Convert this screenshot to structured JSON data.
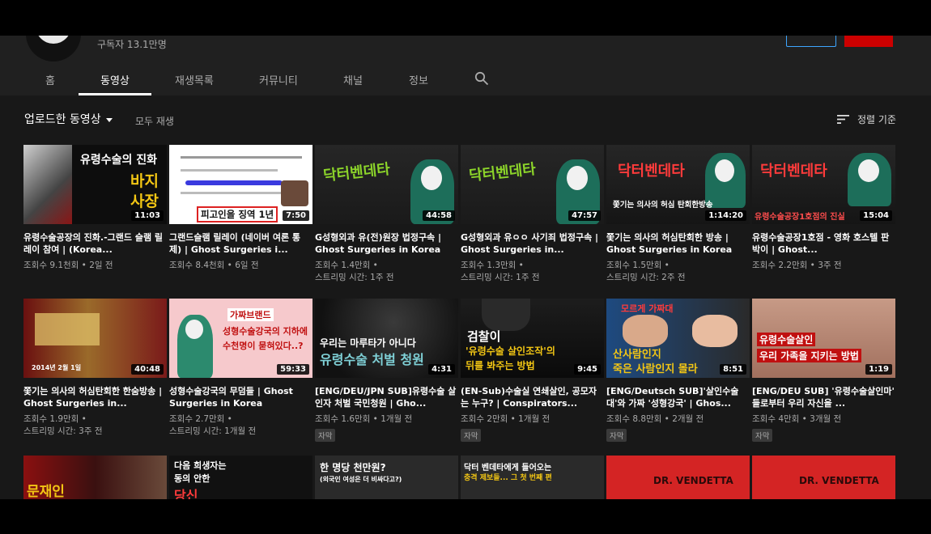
{
  "channel": {
    "subscribers": "구독자 13.1만명"
  },
  "tabs": [
    {
      "label": "홈"
    },
    {
      "label": "동영상"
    },
    {
      "label": "재생목록"
    },
    {
      "label": "커뮤니티"
    },
    {
      "label": "채널"
    },
    {
      "label": "정보"
    }
  ],
  "section": {
    "title": "업로드한 동영상",
    "play_all": "모두 재생",
    "sort": "정렬 기준"
  },
  "videos": [
    {
      "title": "유령수술공장의 진화.-그랜드 슬램 릴레이 참여 | (Korea...",
      "meta1": "조회수 9.1천회 • 2일 전",
      "meta2": "",
      "duration": "11:03",
      "thumb_text1": "유령수술의 진화",
      "thumb_text2": "바지",
      "thumb_text3": "사장"
    },
    {
      "title": "그랜드슬램 릴레이 (네이버 여론 통제) | Ghost Surgeries i...",
      "meta1": "조회수 8.4천회 • 6일 전",
      "meta2": "",
      "duration": "7:50",
      "thumb_text1": "피고인을 징역 1년"
    },
    {
      "title": "G성형외과 유(전)원장 법정구속 | Ghost Surgeries in Korea",
      "meta1": "조회수 1.4만회 •",
      "meta2": "스트리밍 시간: 1주 전",
      "duration": "44:58",
      "thumb_text1": "닥터벤데타"
    },
    {
      "title": "G성형외과 유ㅇㅇ 사기죄 법정구속 | Ghost Surgeries in...",
      "meta1": "조회수 1.3만회 •",
      "meta2": "스트리밍 시간: 1주 전",
      "duration": "47:57",
      "thumb_text1": "닥터벤데타"
    },
    {
      "title": "쫓기는 의사의 허심탄회한 방송 | Ghost Surgeries in Korea",
      "meta1": "조회수 1.5만회 •",
      "meta2": "스트리밍 시간: 2주 전",
      "duration": "1:14:20",
      "thumb_text1": "닥터벤데타",
      "thumb_text2": "쫓기는 의사의 허심 탄회한방송"
    },
    {
      "title": "유령수술공장1호점 - 영화 호스텔 판박이 | Ghost...",
      "meta1": "조회수 2.2만회 • 3주 전",
      "meta2": "",
      "duration": "15:04",
      "thumb_text1": "닥터벤데타",
      "thumb_text2": "유령수술공장1호점의 진실"
    },
    {
      "title": "쫓기는 의사의 허심탄회한 한숨방송 | Ghost Surgeries in...",
      "meta1": "조회수 1.9만회 •",
      "meta2": "스트리밍 시간: 3주 전",
      "duration": "40:48",
      "thumb_text1": "2014년 2월 1일"
    },
    {
      "title": "성형수술강국의 무덤들 | Ghost Surgeries in Korea",
      "meta1": "조회수 2.7만회 •",
      "meta2": "스트리밍 시간: 1개월 전",
      "duration": "59:33",
      "thumb_text1": "가짜브랜드",
      "thumb_text2": "성형수술강국의 지하에",
      "thumb_text3": "수천명이 묻혀있다..?"
    },
    {
      "title": "[ENG/DEU/JPN SUB]유령수술 살인자 처벌 국민청원 | Gho...",
      "meta1": "조회수 1.6만회 • 1개월 전",
      "meta2": "",
      "duration": "4:31",
      "badge": "자막",
      "thumb_text1": "우리는 마루타가 아니다",
      "thumb_text2": "유령수술 처벌 청원"
    },
    {
      "title": "(EN-Sub)수술실 연쇄살인, 공모자는 누구? | Conspirators...",
      "meta1": "조회수 2만회 • 1개월 전",
      "meta2": "",
      "duration": "9:45",
      "badge": "자막",
      "thumb_text1": "검찰이",
      "thumb_text2": "'유령수술 살인조작'의",
      "thumb_text3": "뒤를 봐주는 방법"
    },
    {
      "title": "[ENG/Deutsch SUB]'살인수술대'와 가짜 '성형강국' | Ghos...",
      "meta1": "조회수 8.8만회 • 2개월 전",
      "meta2": "",
      "duration": "8:51",
      "badge": "자막",
      "thumb_text1": "모르게 가짜대",
      "thumb_text2": "산사람인지",
      "thumb_text3": "죽은 사람인지 몰라"
    },
    {
      "title": "[ENG/DEU SUB] '유령수술살인마' 들로부터 우리 자신을 ...",
      "meta1": "조회수 4만회 • 3개월 전",
      "meta2": "",
      "duration": "1:19",
      "badge": "자막",
      "thumb_text1": "유령수술살인",
      "thumb_text2": "우리 가족을 지키는 방법"
    },
    {
      "thumb_text1": "문재인"
    },
    {
      "thumb_text1": "다음 희생자는",
      "thumb_text2": "동의 안한",
      "thumb_text3": "당신"
    },
    {
      "thumb_text1": "한 명당 천만원?",
      "thumb_text2": "(외국인 여성은 더 비싸다고?)"
    },
    {
      "thumb_text1": "닥터 벤데타에게 들어오는",
      "thumb_text2": "충격 제보들... 그 첫 번째 편"
    },
    {
      "thumb_text1": "DR. VENDETTA"
    },
    {
      "thumb_text1": "DR. VENDETTA"
    }
  ]
}
